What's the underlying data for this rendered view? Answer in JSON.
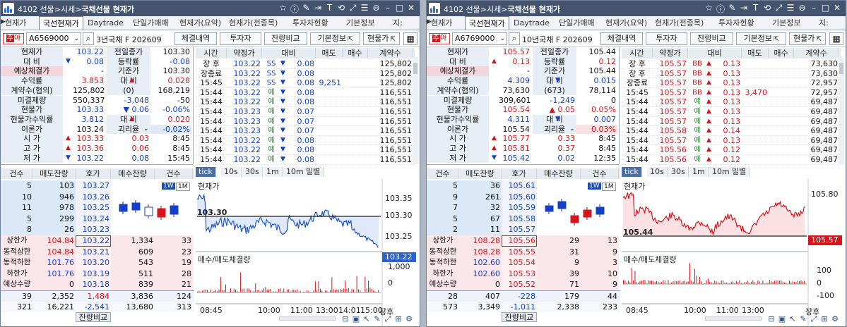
{
  "panels": [
    {
      "id": "left",
      "title_prefix": "4102 선물>시세>",
      "title_bold": "국채선물 현재가",
      "tabs": [
        "현재가",
        "국선현재가",
        "Daytrade",
        "단일가매매",
        "현재가(요약)",
        "현재가(전종목)",
        "투자자현황",
        "기본정보",
        "지:"
      ],
      "code": "A6569000",
      "name": "3년국채 F 202609",
      "buttons": [
        "체결내역",
        "투자자",
        "잔량비교",
        "기본정보",
        "현물가"
      ],
      "info": [
        {
          "l": "현재가",
          "v": "103.22",
          "vc": "blue",
          "a": "",
          "l2": "전일종가",
          "v2": "103.30",
          "v2c": ""
        },
        {
          "l": "대 비",
          "v": "0.08",
          "vc": "blue",
          "a": "down",
          "l2": "등락률",
          "v2": "-0.08",
          "v2c": "blue"
        },
        {
          "l": "예상체결가",
          "v": "-",
          "vc": "",
          "a": "",
          "l2": "기준가",
          "v2": "103.30",
          "v2c": "",
          "lr": true
        },
        {
          "l": "수익률",
          "v": "3.853",
          "vc": "red",
          "a": "",
          "l2": "대 비",
          "v2": "0.028",
          "v2c": "red",
          "a2": "up"
        },
        {
          "l": "계약수(협의)",
          "v": "125,802",
          "vc": "",
          "a": "",
          "l2": "(0)",
          "v2": "168,219",
          "v2c": ""
        },
        {
          "l": "미결제량",
          "v": "550,337",
          "vc": "",
          "a": "",
          "l2": "-3,048",
          "v2": "-50",
          "v2c": "",
          "l2c": "blue"
        },
        {
          "l": "현물가",
          "v": "103.33",
          "vc": "blue",
          "a": "",
          "l2": "▼ 0.06",
          "v2": "-0.06%",
          "v2c": "blue",
          "l2c": "blue"
        },
        {
          "l": "현물가수익률",
          "v": "3.812",
          "vc": "blue",
          "a": "",
          "l2": "대 비",
          "v2": "0.020",
          "v2c": "red",
          "a2": "up"
        },
        {
          "l": "이론가",
          "v": "103.24",
          "vc": "",
          "a": "",
          "l2": "괴리율",
          "v2": "-0.02%",
          "v2c": "blue",
          "dd": true
        },
        {
          "l": "시 가",
          "v": "103.33",
          "vc": "red",
          "a": "up",
          "l2": "0.03",
          "v2": "8:45",
          "v2c": "",
          "l2c": "red"
        },
        {
          "l": "고 가",
          "v": "103.36",
          "vc": "red",
          "a": "up",
          "l2": "0.06",
          "v2": "8:45",
          "v2c": "",
          "l2c": "red"
        },
        {
          "l": "저 가",
          "v": "103.22",
          "vc": "blue",
          "a": "down",
          "l2": "0.08",
          "v2": "15:45",
          "v2c": "",
          "l2c": "blue"
        }
      ],
      "tick_header": [
        "시간",
        "약정가",
        "대비",
        "매도",
        "매수",
        "계약수"
      ],
      "ticks": [
        [
          "장 후",
          "103.22",
          "SS",
          "0.08",
          "",
          "125,802"
        ],
        [
          "장종료",
          "103.22",
          "SS",
          "0.08",
          "",
          "125,802"
        ],
        [
          "15:45",
          "103.22",
          "SS",
          "0.08",
          "9,251",
          "125,802"
        ],
        [
          "15:44",
          "103.22",
          "예",
          "0.08",
          "",
          "116,551"
        ],
        [
          "15:44",
          "103.22",
          "예",
          "0.08",
          "",
          "116,551"
        ],
        [
          "15:44",
          "103.23",
          "예",
          "0.07",
          "",
          "116,551"
        ],
        [
          "15:44",
          "103.23",
          "예",
          "0.07",
          "",
          "116,551"
        ],
        [
          "15:44",
          "103.23",
          "예",
          "0.07",
          "",
          "116,551"
        ],
        [
          "15:44",
          "103.22",
          "예",
          "0.08",
          "",
          "116,551"
        ],
        [
          "15:44",
          "103.22",
          "예",
          "0.08",
          "",
          "116,551"
        ],
        [
          "15:44",
          "103.22",
          "예",
          "0.08",
          "",
          "116,551"
        ]
      ],
      "ob_header": [
        "건수",
        "매도잔량",
        "호가",
        "매수잔량",
        "건수"
      ],
      "asks": [
        [
          "5",
          "103",
          "103.27"
        ],
        [
          "10",
          "946",
          "103.26"
        ],
        [
          "11",
          "978",
          "103.25"
        ],
        [
          "5",
          "299",
          "103.24"
        ],
        [
          "8",
          "26",
          "103.23"
        ]
      ],
      "mids": [
        [
          "상한가",
          "104.84"
        ],
        [
          "동적상한",
          "104.84"
        ],
        [
          "동적하한",
          "101.76"
        ],
        [
          "하한가",
          "101.76"
        ],
        [
          "예상수량",
          "0"
        ]
      ],
      "bids": [
        [
          "103.22",
          "1,334",
          "33"
        ],
        [
          "103.21",
          "609",
          "23"
        ],
        [
          "103.20",
          "543",
          "19"
        ],
        [
          "103.19",
          "511",
          "28"
        ],
        [
          "103.18",
          "839",
          "21"
        ]
      ],
      "tot1": [
        "39",
        "2,352",
        "1,484",
        "3,836",
        "124"
      ],
      "tot2": [
        "321",
        "16,221",
        "-2,541",
        "13,680",
        "313"
      ],
      "bottom_btn": "잔량비교",
      "chart_tabs": [
        "tick",
        "10s",
        "30s",
        "1m",
        "10m",
        "일별"
      ],
      "chart_title": "현재가",
      "chart_ref": "103.30",
      "chart_cur": "103.22",
      "chart_axis": [
        "103.35",
        "103.30",
        "103.25",
        "103.22"
      ],
      "vol_title": "매수/매도체결량",
      "vol_axis": [
        "1,000",
        "0"
      ],
      "time_axis": [
        "08:45",
        "10:00",
        "11:00",
        "13:00",
        "14:01",
        "15:00",
        "장후"
      ],
      "candle_buttons": [
        "1W",
        "1M"
      ]
    },
    {
      "id": "right",
      "title_prefix": "4102 선물>시세>",
      "title_bold": "국채선물 현재가",
      "tabs": [
        "현재가",
        "국선현재가",
        "Daytrade",
        "단일가매매",
        "현재가(요약)",
        "현재가(전종목)",
        "투자자현황",
        "기본정보",
        "지:"
      ],
      "code": "A6769000",
      "name": "10년국채 F 202609",
      "buttons": [
        "체결내역",
        "투자자",
        "잔량비교",
        "기본정보",
        "현물가"
      ],
      "info": [
        {
          "l": "현재가",
          "v": "105.57",
          "vc": "red",
          "a": "",
          "l2": "전일종가",
          "v2": "105.44",
          "v2c": ""
        },
        {
          "l": "대 비",
          "v": "0.13",
          "vc": "red",
          "a": "up",
          "l2": "등락률",
          "v2": "0.12",
          "v2c": "red"
        },
        {
          "l": "예상체결가",
          "v": "-",
          "vc": "",
          "a": "",
          "l2": "기준가",
          "v2": "105.44",
          "v2c": "",
          "lr": true
        },
        {
          "l": "수익률",
          "v": "4.309",
          "vc": "blue",
          "a": "",
          "l2": "대 비",
          "v2": "0.015",
          "v2c": "blue",
          "a2": "down"
        },
        {
          "l": "계약수(협의)",
          "v": "73,630",
          "vc": "",
          "a": "",
          "l2": "(673)",
          "v2": "78,114",
          "v2c": ""
        },
        {
          "l": "미결제량",
          "v": "309,601",
          "vc": "",
          "a": "",
          "l2": "-1,249",
          "v2": "0",
          "v2c": "",
          "l2c": "blue"
        },
        {
          "l": "현물가",
          "v": "105.54",
          "vc": "red",
          "a": "",
          "l2": "▲ 0.05",
          "v2": "0.05%",
          "v2c": "red",
          "l2c": "red"
        },
        {
          "l": "현물가수익률",
          "v": "4.311",
          "vc": "blue",
          "a": "",
          "l2": "대 비",
          "v2": "0.007",
          "v2c": "blue",
          "a2": "down"
        },
        {
          "l": "이론가",
          "v": "105.54",
          "vc": "",
          "a": "",
          "l2": "괴리율",
          "v2": "0.03%",
          "v2c": "red",
          "dd": true
        },
        {
          "l": "시 가",
          "v": "105.77",
          "vc": "red",
          "a": "up",
          "l2": "0.33",
          "v2": "8:45",
          "v2c": "",
          "l2c": "red"
        },
        {
          "l": "고 가",
          "v": "105.81",
          "vc": "red",
          "a": "up",
          "l2": "0.37",
          "v2": "8:45",
          "v2c": "",
          "l2c": "red"
        },
        {
          "l": "저 가",
          "v": "105.42",
          "vc": "blue",
          "a": "down",
          "l2": "0.02",
          "v2": "12:35",
          "v2c": "",
          "l2c": "blue"
        }
      ],
      "tick_header": [
        "시간",
        "약정가",
        "대비",
        "매도",
        "매수",
        "계약수"
      ],
      "ticks": [
        [
          "장 후",
          "105.57",
          "BB",
          "0.13",
          "",
          "73,630"
        ],
        [
          "장 후",
          "105.57",
          "BB",
          "0.13",
          "",
          "73,630"
        ],
        [
          "장종료",
          "105.57",
          "BB",
          "0.13",
          "",
          "72,957"
        ],
        [
          "15:45",
          "105.57",
          "BB",
          "0.13",
          "3,470",
          "72,957"
        ],
        [
          "15:44",
          "105.57",
          "예",
          "0.13",
          "",
          "69,487"
        ],
        [
          "15:44",
          "105.57",
          "예",
          "0.13",
          "",
          "69,487"
        ],
        [
          "15:44",
          "105.57",
          "예",
          "0.13",
          "",
          "69,487"
        ],
        [
          "15:44",
          "105.58",
          "예",
          "0.14",
          "",
          "69,487"
        ],
        [
          "15:44",
          "105.57",
          "예",
          "0.13",
          "",
          "69,487"
        ],
        [
          "15:44",
          "105.56",
          "예",
          "0.12",
          "",
          "69,487"
        ],
        [
          "15:44",
          "105.56",
          "예",
          "0.12",
          "",
          "69,487"
        ]
      ],
      "ob_header": [
        "건수",
        "매도잔량",
        "호가",
        "매수잔량",
        "건수"
      ],
      "asks": [
        [
          "5",
          "36",
          "105.61"
        ],
        [
          "9",
          "261",
          "105.60"
        ],
        [
          "7",
          "32",
          "105.59"
        ],
        [
          "5",
          "67",
          "105.58"
        ],
        [
          "2",
          "11",
          "105.57"
        ]
      ],
      "mids": [
        [
          "상한가",
          "108.28"
        ],
        [
          "동적상한",
          "108.28"
        ],
        [
          "동적하한",
          "102.60"
        ],
        [
          "하한가",
          "102.60"
        ],
        [
          "예상수량",
          "0"
        ]
      ],
      "bids": [
        [
          "105.56",
          "29",
          "13"
        ],
        [
          "105.55",
          "31",
          "9"
        ],
        [
          "105.54",
          "9",
          "3"
        ],
        [
          "105.53",
          "39",
          "10"
        ],
        [
          "105.52",
          "71",
          "9"
        ]
      ],
      "tot1": [
        "28",
        "407",
        "-228",
        "179",
        "44"
      ],
      "tot2": [
        "573",
        "3,349",
        "-1,011",
        "2,338",
        "233"
      ],
      "bottom_btn": "잔량비교",
      "chart_tabs": [
        "tick",
        "10s",
        "30s",
        "1m",
        "10m",
        "일별"
      ],
      "chart_title": "현재가",
      "chart_ref": "105.44",
      "chart_cur": "105.57",
      "chart_axis": [
        "105.80",
        "105.57"
      ],
      "vol_title": "매수/매도체결량",
      "vol_axis": [
        "100",
        "0",
        "-100"
      ],
      "time_axis": [
        "08:45",
        "10:00",
        "11:00",
        "13:00",
        "장후"
      ],
      "candle_buttons": [
        "1W",
        "1M"
      ]
    }
  ],
  "colors": {
    "up": "#d4151d",
    "down": "#1440c7",
    "titlebar": "#44546f",
    "fill_left": "#dfe9fb",
    "fill_right": "#fbe1e4"
  }
}
